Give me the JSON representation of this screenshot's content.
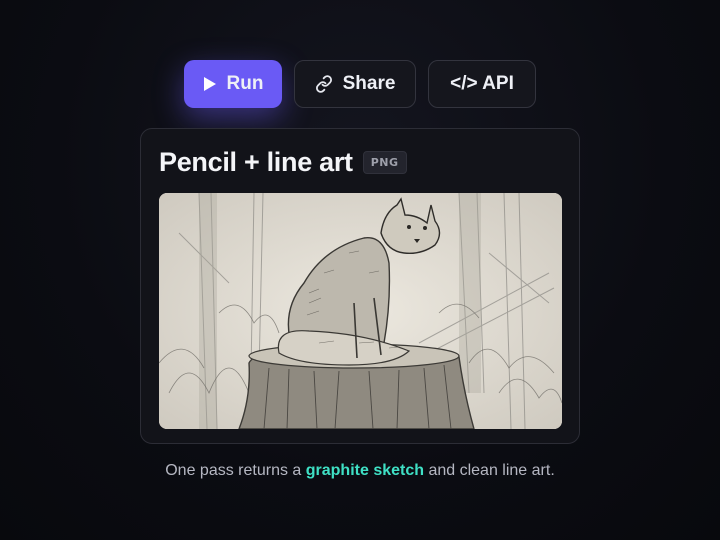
{
  "toolbar": {
    "run_label": "Run",
    "share_label": "Share",
    "api_label": "</> API",
    "run_icon": "play-icon",
    "share_icon": "link-icon"
  },
  "card": {
    "title": "Pencil + line art",
    "badge": "PNG",
    "image": "pencil sketch of a fox sitting on a tree stump in a forest"
  },
  "caption": {
    "prefix": "One pass returns a ",
    "highlight": "graphite sketch",
    "suffix": " and clean line art."
  },
  "colors": {
    "accent": "#6a5af5",
    "highlight": "#3fe0c5",
    "background": "#0b0c12",
    "card": "#121319"
  }
}
